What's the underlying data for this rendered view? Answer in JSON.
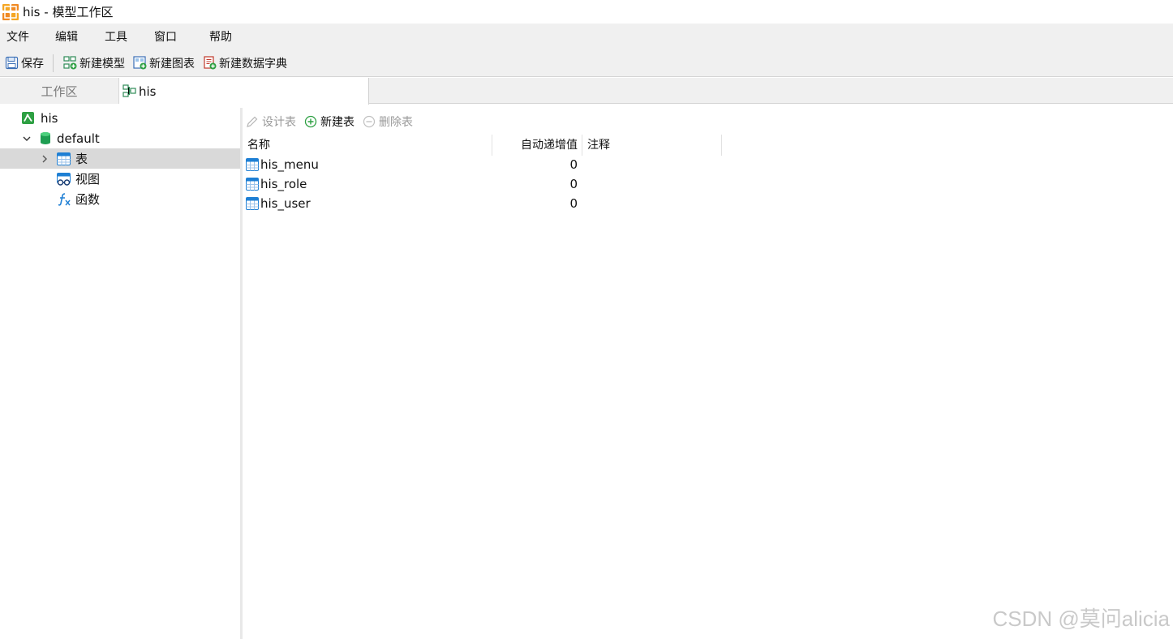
{
  "window": {
    "title": "his - 模型工作区",
    "app_icon": "navicat-model-icon"
  },
  "menu": {
    "items": [
      "文件",
      "编辑",
      "工具",
      "窗口",
      "帮助"
    ]
  },
  "toolbar": {
    "save_label": "保存",
    "new_model_label": "新建模型",
    "new_diagram_label": "新建图表",
    "new_dictionary_label": "新建数据字典"
  },
  "tabs": {
    "workspace_label": "工作区",
    "model_label": "his"
  },
  "tree": {
    "root_label": "his",
    "schema_label": "default",
    "tables_label": "表",
    "views_label": "视图",
    "functions_label": "函数"
  },
  "object_toolbar": {
    "design_label": "设计表",
    "new_label": "新建表",
    "delete_label": "删除表"
  },
  "table_grid": {
    "columns": [
      "名称",
      "自动递增值",
      "注释"
    ],
    "rows": [
      {
        "name": "his_menu",
        "auto_increment": "0",
        "comment": ""
      },
      {
        "name": "his_role",
        "auto_increment": "0",
        "comment": ""
      },
      {
        "name": "his_user",
        "auto_increment": "0",
        "comment": ""
      }
    ]
  },
  "watermark": "CSDN @莫问alicia",
  "colors": {
    "chrome_bg": "#f0f0f0",
    "selected_row": "#d9d9d9",
    "accent_green": "#2ea043",
    "table_icon_blue": "#1e7fd4"
  }
}
